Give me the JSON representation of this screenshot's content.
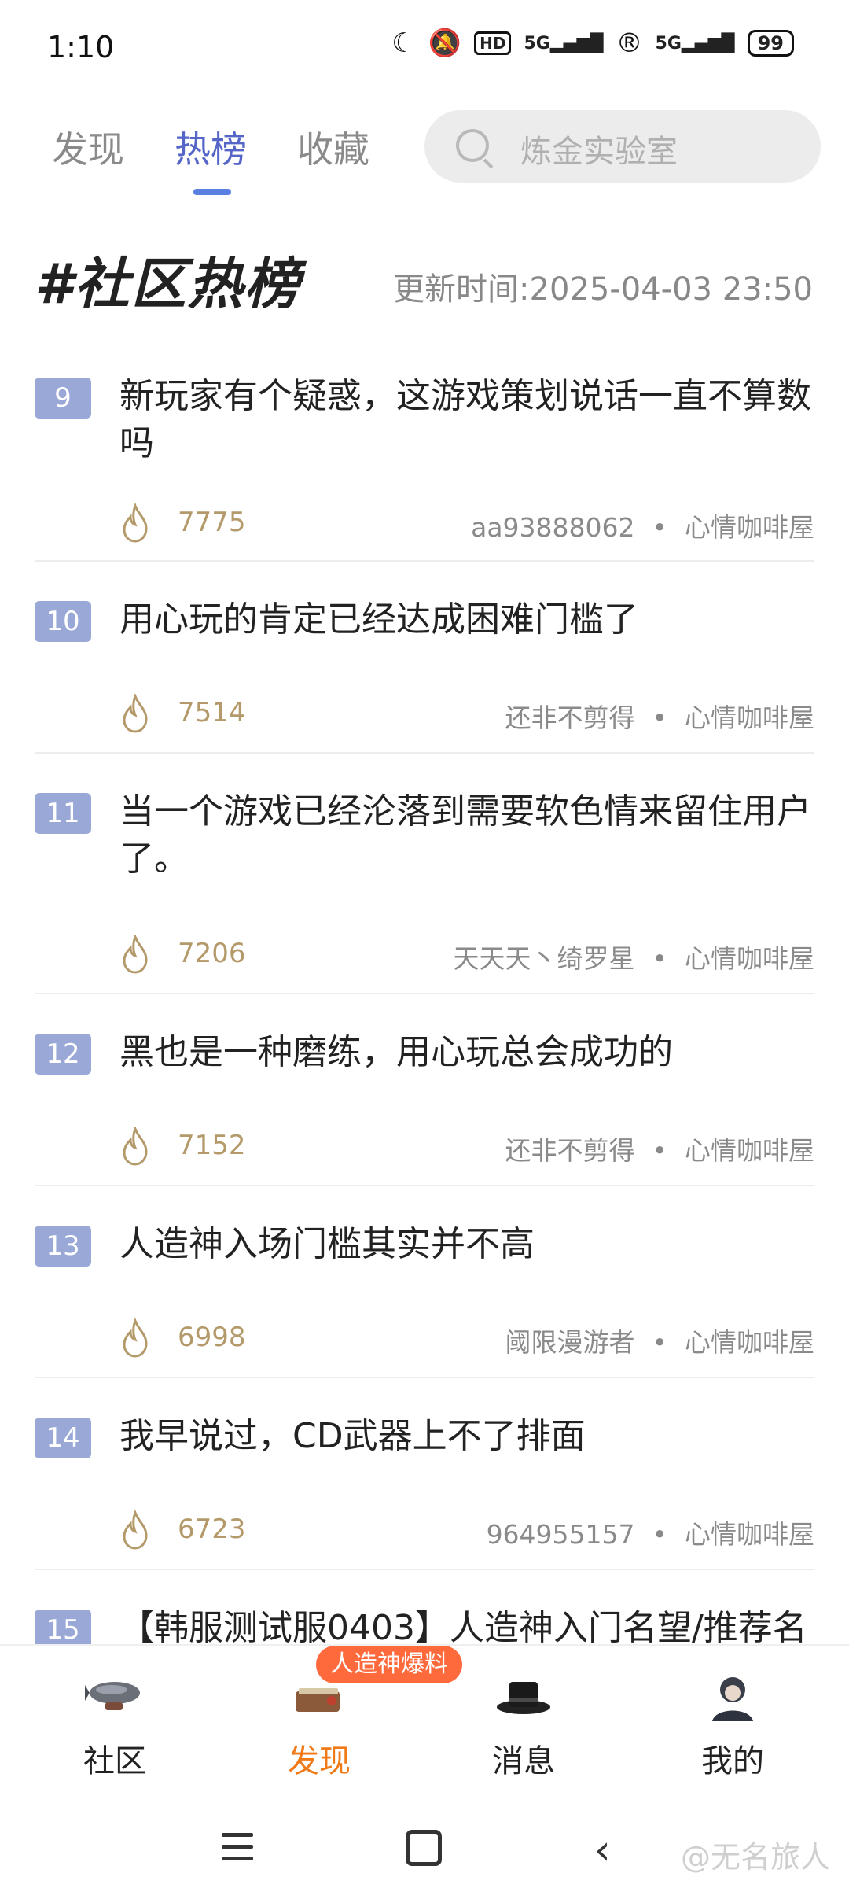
{
  "status": {
    "time": "1:10",
    "hd": "HD",
    "sig1": "5G",
    "sig2": "5G",
    "battery": "99"
  },
  "tabs": [
    {
      "label": "发现",
      "active": false
    },
    {
      "label": "热榜",
      "active": true
    },
    {
      "label": "收藏",
      "active": false
    }
  ],
  "search": {
    "placeholder": "炼金实验室"
  },
  "header": {
    "title": "#社区热榜",
    "update_label": "更新时间:",
    "update_time": "2025-04-03 23:50"
  },
  "items": [
    {
      "rank": "9",
      "title": "新玩家有个疑惑，这游戏策划说话一直不算数吗",
      "heat": "7775",
      "author": "aa93888062",
      "board": "心情咖啡屋"
    },
    {
      "rank": "10",
      "title": "用心玩的肯定已经达成困难门槛了",
      "heat": "7514",
      "author": "还非不剪得",
      "board": "心情咖啡屋"
    },
    {
      "rank": "11",
      "title": "当一个游戏已经沦落到需要软色情来留住用户了。",
      "heat": "7206",
      "author": "天天天丶绮罗星",
      "board": "心情咖啡屋"
    },
    {
      "rank": "12",
      "title": "黑也是一种磨练，用心玩总会成功的",
      "heat": "7152",
      "author": "还非不剪得",
      "board": "心情咖啡屋"
    },
    {
      "rank": "13",
      "title": "人造神入场门槛其实并不高",
      "heat": "6998",
      "author": "阈限漫游者",
      "board": "心情咖啡屋"
    },
    {
      "rank": "14",
      "title": "我早说过，CD武器上不了排面",
      "heat": "6723",
      "author": "964955157",
      "board": "心情咖啡屋"
    },
    {
      "rank": "15",
      "title": "【韩服测试服0403】人造神入门名望/推荐名",
      "heat": "",
      "author": "",
      "board": ""
    }
  ],
  "bottom_nav": [
    {
      "label": "社区",
      "icon": "airship-icon",
      "active": false
    },
    {
      "label": "发现",
      "icon": "book-icon",
      "active": true
    },
    {
      "label": "消息",
      "icon": "top-hat-icon",
      "active": false
    },
    {
      "label": "我的",
      "icon": "avatar-icon",
      "active": false
    }
  ],
  "promo_badge": "人造神爆料",
  "watermark": "@无名旅人",
  "colors": {
    "accent": "#5566c8",
    "badge": "#9aa8d8",
    "heat": "#b49a6a",
    "active_nav": "#f07a18",
    "promo": "#ff6a3d"
  }
}
